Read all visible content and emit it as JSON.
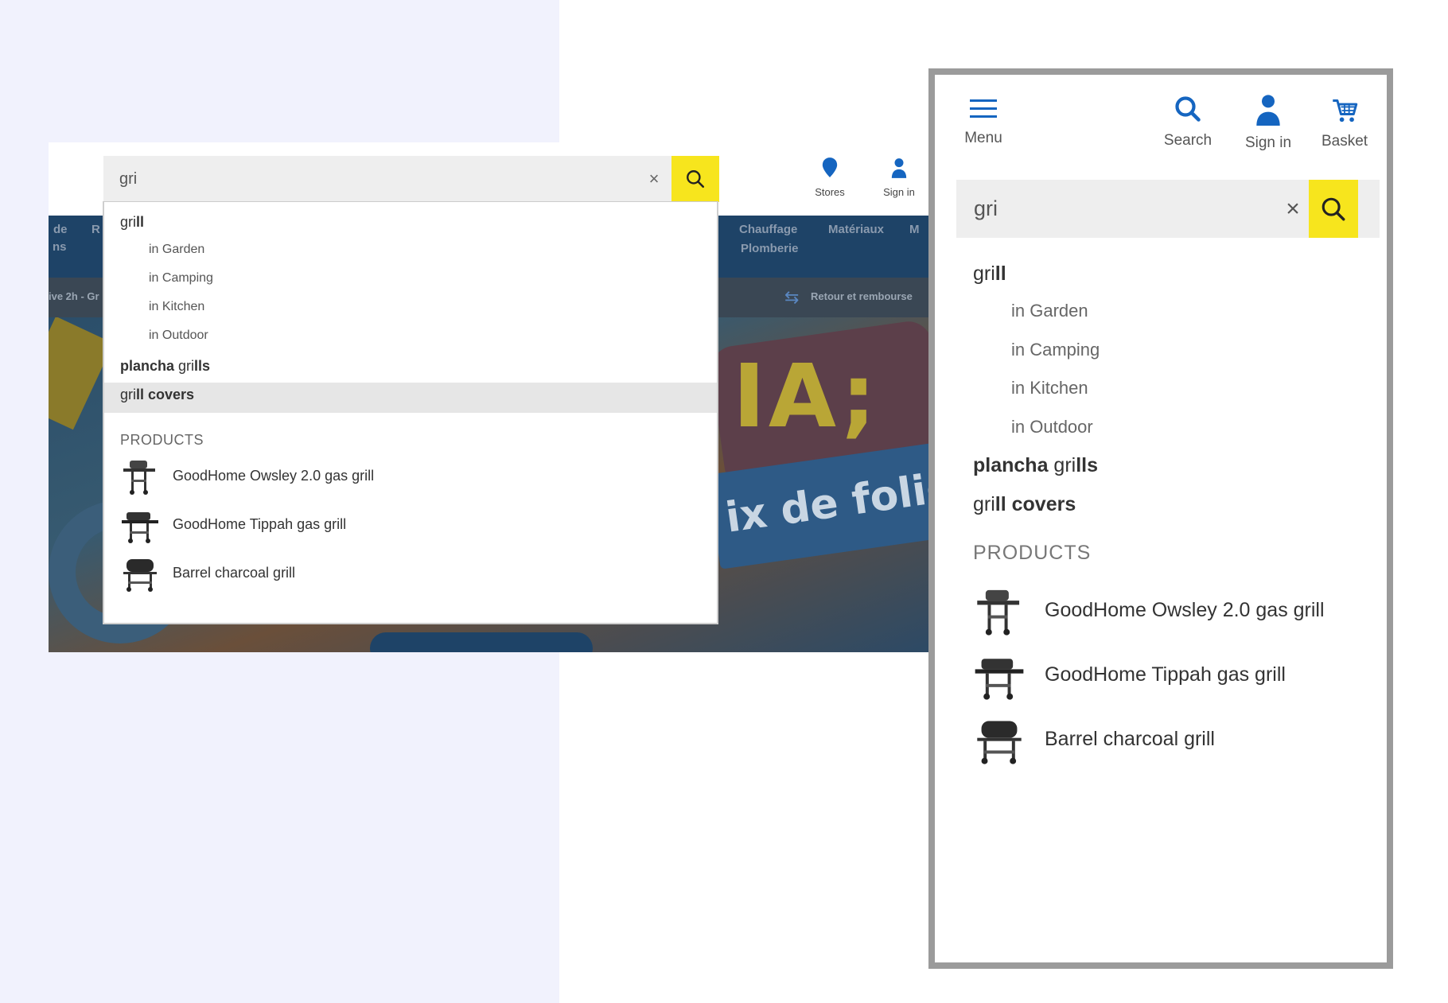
{
  "desktop": {
    "nav_items": [
      "de",
      "R",
      "Chauffage",
      "Matériaux",
      "M"
    ],
    "nav_sub": [
      "ns",
      "Plomberie"
    ],
    "strip_left": "ive 2h - Gr",
    "strip_right": "Retour et rembourse",
    "hero_letters": "IA;",
    "hero_banner": "ix de folie !",
    "search": {
      "value": "gri",
      "clear_label": "×"
    },
    "header_links": {
      "stores": "Stores",
      "sign_in": "Sign in"
    },
    "suggestions": {
      "grill_prefix": "gri",
      "grill_suffix": "ll",
      "subcategories": [
        "in Garden",
        "in Camping",
        "in Kitchen",
        "in Outdoor"
      ],
      "plancha_bold1": "plancha ",
      "plancha_mid": "gri",
      "plancha_bold2": "lls",
      "covers_prefix": "gri",
      "covers_bold": "ll covers"
    },
    "products_header": "PRODUCTS",
    "products": [
      "GoodHome Owsley 2.0 gas grill",
      "GoodHome Tippah gas grill",
      "Barrel charcoal grill"
    ]
  },
  "mobile": {
    "header": {
      "menu": "Menu",
      "search": "Search",
      "sign_in": "Sign in",
      "basket": "Basket"
    },
    "search": {
      "value": "gri",
      "clear_label": "×"
    },
    "suggestions": {
      "grill_prefix": "gri",
      "grill_suffix": "ll",
      "subcategories": [
        "in Garden",
        "in Camping",
        "in Kitchen",
        "in Outdoor"
      ],
      "plancha_bold1": "plancha ",
      "plancha_mid": "gri",
      "plancha_bold2": "lls",
      "covers_prefix": "gri",
      "covers_bold": "ll covers"
    },
    "products_header": "PRODUCTS",
    "products": [
      "GoodHome Owsley 2.0 gas grill",
      "GoodHome Tippah gas grill",
      "Barrel charcoal grill"
    ]
  },
  "colors": {
    "brand_blue": "#1565c0",
    "search_yellow": "#f7e51d"
  }
}
